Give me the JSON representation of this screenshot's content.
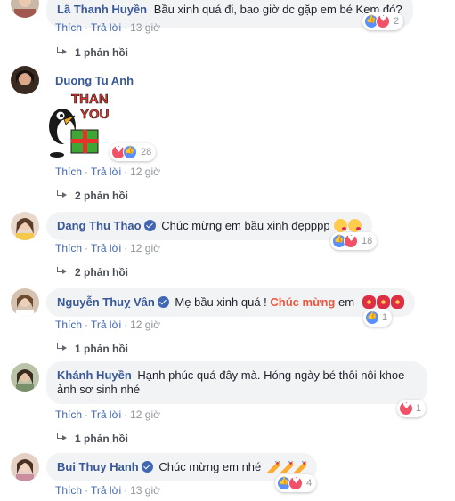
{
  "actions": {
    "like": "Thích",
    "reply": "Trả lời",
    "dot": "·"
  },
  "comments": [
    {
      "author": "Lã Thanh Huyền",
      "text": "Bầu xinh quá đi, bao giờ dc gặp em bé Kem đó?",
      "time": "13 giờ",
      "reaction_count": "2",
      "replies": "1 phản hồi"
    },
    {
      "author": "Duong Tu Anh",
      "sticker_text": [
        "THANK",
        "YOU!"
      ],
      "time": "12 giờ",
      "reaction_count": "28",
      "replies": "2 phản hồi"
    },
    {
      "author": "Dang Thu Thao",
      "text": "Chúc mừng em bầu xinh đẹpppp",
      "emojis": [
        "kissing-face-emoji",
        "kissing-face-emoji"
      ],
      "time": "12 giờ",
      "reaction_count": "18",
      "replies": "2 phản hồi"
    },
    {
      "author": "Nguyễn Thuỵ Vân",
      "text": "Mẹ bầu xinh quá !",
      "highlight": "Chúc mừng",
      "text_after": "em",
      "emojis": [
        "hibiscus-emoji",
        "hibiscus-emoji",
        "hibiscus-emoji"
      ],
      "time": "12 giờ",
      "reaction_count": "1",
      "replies": "1 phản hồi"
    },
    {
      "author": "Khánh Huyền",
      "text": "Hạnh phúc quá đây mà. Hóng ngày bé thôi nôi khoe ảnh sơ sinh nhé",
      "time": "12 giờ",
      "reaction_count": "1",
      "replies": "1 phản hồi"
    },
    {
      "author": "Bui Thuy Hanh",
      "text": "Chúc mừng em nhé",
      "emojis": [
        "party-popper-emoji",
        "party-popper-emoji",
        "party-popper-emoji"
      ],
      "time": "13 giờ",
      "reaction_count": "4"
    }
  ],
  "colors": {
    "author": "#385898",
    "action": "#4267b2",
    "bubble": "#f2f3f5",
    "highlight": "#e9573f"
  }
}
